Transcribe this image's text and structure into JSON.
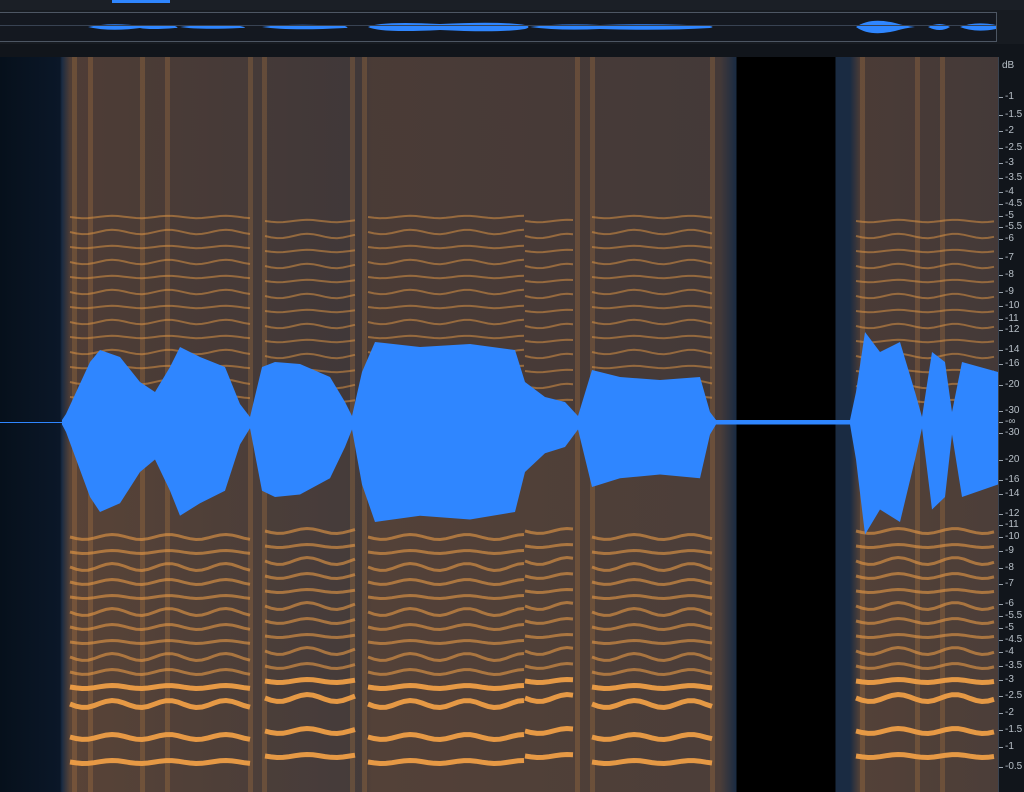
{
  "scale": {
    "unit": "dB",
    "upper_labels": [
      "-1",
      "-1.5",
      "-2",
      "-2.5",
      "-3",
      "-3.5",
      "-4",
      "-4.5",
      "-5",
      "-5.5",
      "-6",
      "-7",
      "-8",
      "-9",
      "-10",
      "-11",
      "-12",
      "-14",
      "-16",
      "-20",
      "-30"
    ],
    "center_label": "-∞",
    "lower_labels": [
      "-30",
      "-20",
      "-16",
      "-14",
      "-12",
      "-11",
      "-10",
      "-9",
      "-8",
      "-7",
      "-6",
      "-5.5",
      "-5",
      "-4.5",
      "-4",
      "-3.5",
      "-3",
      "-2.5",
      "-2",
      "-1.5",
      "-1",
      "-0.5"
    ]
  },
  "colors": {
    "waveform": "#2f86ff",
    "harmonic": "#f6a347",
    "background": "#1a2b42",
    "silence": "#000000"
  }
}
